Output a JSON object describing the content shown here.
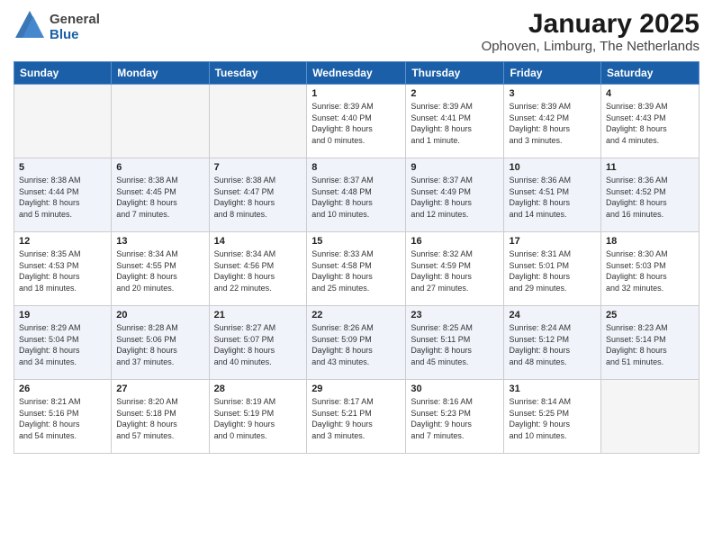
{
  "header": {
    "logo_general": "General",
    "logo_blue": "Blue",
    "title": "January 2025",
    "subtitle": "Ophoven, Limburg, The Netherlands"
  },
  "weekdays": [
    "Sunday",
    "Monday",
    "Tuesday",
    "Wednesday",
    "Thursday",
    "Friday",
    "Saturday"
  ],
  "weeks": [
    [
      {
        "day": "",
        "empty": true
      },
      {
        "day": "",
        "empty": true
      },
      {
        "day": "",
        "empty": true
      },
      {
        "day": "1",
        "line1": "Sunrise: 8:39 AM",
        "line2": "Sunset: 4:40 PM",
        "line3": "Daylight: 8 hours",
        "line4": "and 0 minutes."
      },
      {
        "day": "2",
        "line1": "Sunrise: 8:39 AM",
        "line2": "Sunset: 4:41 PM",
        "line3": "Daylight: 8 hours",
        "line4": "and 1 minute."
      },
      {
        "day": "3",
        "line1": "Sunrise: 8:39 AM",
        "line2": "Sunset: 4:42 PM",
        "line3": "Daylight: 8 hours",
        "line4": "and 3 minutes."
      },
      {
        "day": "4",
        "line1": "Sunrise: 8:39 AM",
        "line2": "Sunset: 4:43 PM",
        "line3": "Daylight: 8 hours",
        "line4": "and 4 minutes."
      }
    ],
    [
      {
        "day": "5",
        "line1": "Sunrise: 8:38 AM",
        "line2": "Sunset: 4:44 PM",
        "line3": "Daylight: 8 hours",
        "line4": "and 5 minutes."
      },
      {
        "day": "6",
        "line1": "Sunrise: 8:38 AM",
        "line2": "Sunset: 4:45 PM",
        "line3": "Daylight: 8 hours",
        "line4": "and 7 minutes."
      },
      {
        "day": "7",
        "line1": "Sunrise: 8:38 AM",
        "line2": "Sunset: 4:47 PM",
        "line3": "Daylight: 8 hours",
        "line4": "and 8 minutes."
      },
      {
        "day": "8",
        "line1": "Sunrise: 8:37 AM",
        "line2": "Sunset: 4:48 PM",
        "line3": "Daylight: 8 hours",
        "line4": "and 10 minutes."
      },
      {
        "day": "9",
        "line1": "Sunrise: 8:37 AM",
        "line2": "Sunset: 4:49 PM",
        "line3": "Daylight: 8 hours",
        "line4": "and 12 minutes."
      },
      {
        "day": "10",
        "line1": "Sunrise: 8:36 AM",
        "line2": "Sunset: 4:51 PM",
        "line3": "Daylight: 8 hours",
        "line4": "and 14 minutes."
      },
      {
        "day": "11",
        "line1": "Sunrise: 8:36 AM",
        "line2": "Sunset: 4:52 PM",
        "line3": "Daylight: 8 hours",
        "line4": "and 16 minutes."
      }
    ],
    [
      {
        "day": "12",
        "line1": "Sunrise: 8:35 AM",
        "line2": "Sunset: 4:53 PM",
        "line3": "Daylight: 8 hours",
        "line4": "and 18 minutes."
      },
      {
        "day": "13",
        "line1": "Sunrise: 8:34 AM",
        "line2": "Sunset: 4:55 PM",
        "line3": "Daylight: 8 hours",
        "line4": "and 20 minutes."
      },
      {
        "day": "14",
        "line1": "Sunrise: 8:34 AM",
        "line2": "Sunset: 4:56 PM",
        "line3": "Daylight: 8 hours",
        "line4": "and 22 minutes."
      },
      {
        "day": "15",
        "line1": "Sunrise: 8:33 AM",
        "line2": "Sunset: 4:58 PM",
        "line3": "Daylight: 8 hours",
        "line4": "and 25 minutes."
      },
      {
        "day": "16",
        "line1": "Sunrise: 8:32 AM",
        "line2": "Sunset: 4:59 PM",
        "line3": "Daylight: 8 hours",
        "line4": "and 27 minutes."
      },
      {
        "day": "17",
        "line1": "Sunrise: 8:31 AM",
        "line2": "Sunset: 5:01 PM",
        "line3": "Daylight: 8 hours",
        "line4": "and 29 minutes."
      },
      {
        "day": "18",
        "line1": "Sunrise: 8:30 AM",
        "line2": "Sunset: 5:03 PM",
        "line3": "Daylight: 8 hours",
        "line4": "and 32 minutes."
      }
    ],
    [
      {
        "day": "19",
        "line1": "Sunrise: 8:29 AM",
        "line2": "Sunset: 5:04 PM",
        "line3": "Daylight: 8 hours",
        "line4": "and 34 minutes."
      },
      {
        "day": "20",
        "line1": "Sunrise: 8:28 AM",
        "line2": "Sunset: 5:06 PM",
        "line3": "Daylight: 8 hours",
        "line4": "and 37 minutes."
      },
      {
        "day": "21",
        "line1": "Sunrise: 8:27 AM",
        "line2": "Sunset: 5:07 PM",
        "line3": "Daylight: 8 hours",
        "line4": "and 40 minutes."
      },
      {
        "day": "22",
        "line1": "Sunrise: 8:26 AM",
        "line2": "Sunset: 5:09 PM",
        "line3": "Daylight: 8 hours",
        "line4": "and 43 minutes."
      },
      {
        "day": "23",
        "line1": "Sunrise: 8:25 AM",
        "line2": "Sunset: 5:11 PM",
        "line3": "Daylight: 8 hours",
        "line4": "and 45 minutes."
      },
      {
        "day": "24",
        "line1": "Sunrise: 8:24 AM",
        "line2": "Sunset: 5:12 PM",
        "line3": "Daylight: 8 hours",
        "line4": "and 48 minutes."
      },
      {
        "day": "25",
        "line1": "Sunrise: 8:23 AM",
        "line2": "Sunset: 5:14 PM",
        "line3": "Daylight: 8 hours",
        "line4": "and 51 minutes."
      }
    ],
    [
      {
        "day": "26",
        "line1": "Sunrise: 8:21 AM",
        "line2": "Sunset: 5:16 PM",
        "line3": "Daylight: 8 hours",
        "line4": "and 54 minutes."
      },
      {
        "day": "27",
        "line1": "Sunrise: 8:20 AM",
        "line2": "Sunset: 5:18 PM",
        "line3": "Daylight: 8 hours",
        "line4": "and 57 minutes."
      },
      {
        "day": "28",
        "line1": "Sunrise: 8:19 AM",
        "line2": "Sunset: 5:19 PM",
        "line3": "Daylight: 9 hours",
        "line4": "and 0 minutes."
      },
      {
        "day": "29",
        "line1": "Sunrise: 8:17 AM",
        "line2": "Sunset: 5:21 PM",
        "line3": "Daylight: 9 hours",
        "line4": "and 3 minutes."
      },
      {
        "day": "30",
        "line1": "Sunrise: 8:16 AM",
        "line2": "Sunset: 5:23 PM",
        "line3": "Daylight: 9 hours",
        "line4": "and 7 minutes."
      },
      {
        "day": "31",
        "line1": "Sunrise: 8:14 AM",
        "line2": "Sunset: 5:25 PM",
        "line3": "Daylight: 9 hours",
        "line4": "and 10 minutes."
      },
      {
        "day": "",
        "empty": true
      }
    ]
  ]
}
